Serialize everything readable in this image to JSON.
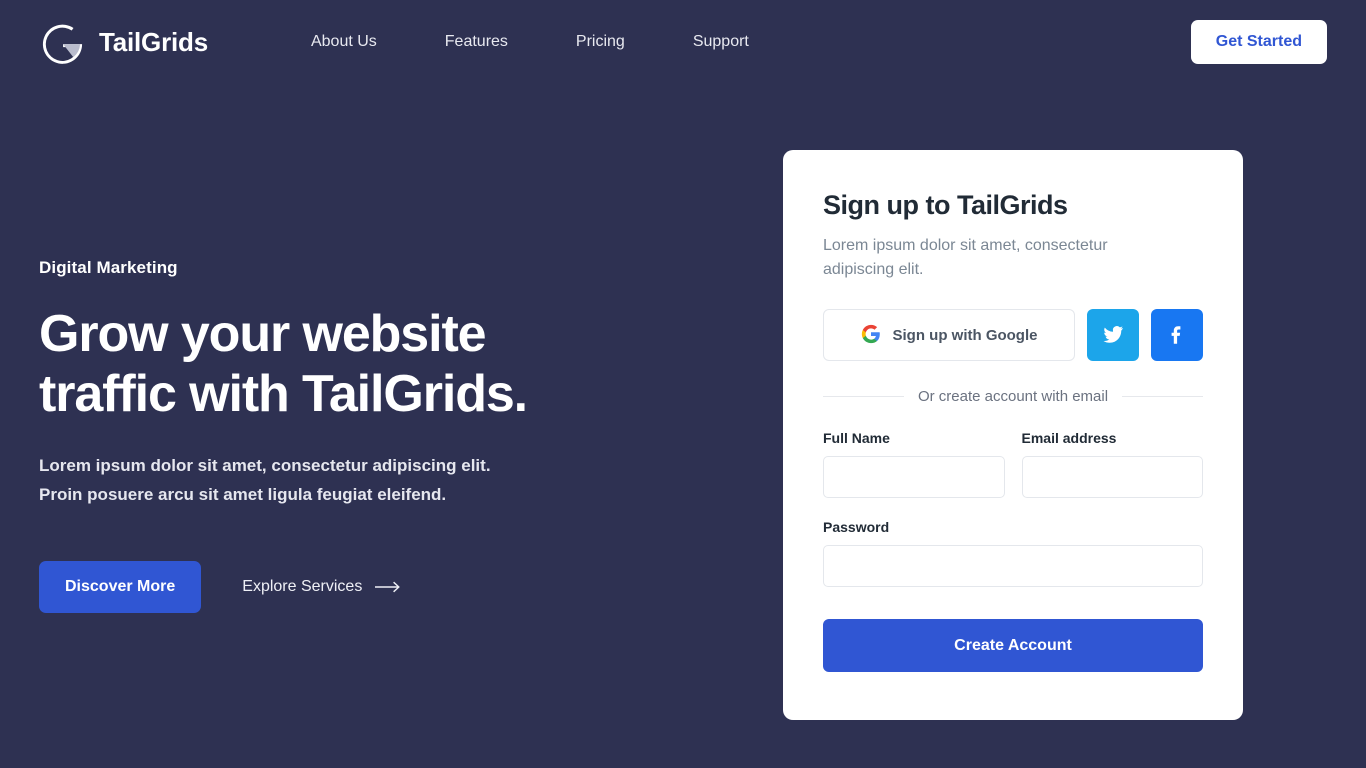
{
  "colors": {
    "page_background": "#2E3152",
    "accent_blue": "#3056D3",
    "card_background": "#FFFFFF",
    "twitter_blue": "#1CA5EA",
    "facebook_blue": "#1877F2",
    "heading_dark": "#212B36",
    "muted_gray": "#7B8794"
  },
  "header": {
    "brand": {
      "name": "TailGrids",
      "logo_icon": "tailgrids-g-logo-icon"
    },
    "nav": [
      {
        "label": "About Us"
      },
      {
        "label": "Features"
      },
      {
        "label": "Pricing"
      },
      {
        "label": "Support"
      }
    ],
    "cta": {
      "label": "Get Started"
    }
  },
  "hero": {
    "eyebrow": "Digital Marketing",
    "title_line1": "Grow your website",
    "title_line2": "traffic with TailGrids.",
    "subtitle_line1": "Lorem ipsum dolor sit amet, consectetur adipiscing elit.",
    "subtitle_line2": "Proin posuere arcu sit amet ligula feugiat eleifend.",
    "primary_button": {
      "label": "Discover More"
    },
    "secondary_link": {
      "label": "Explore Services",
      "icon": "arrow-right-icon"
    }
  },
  "signup": {
    "title": "Sign up to TailGrids",
    "subtitle_line1": "Lorem ipsum dolor sit amet, consectetur",
    "subtitle_line2": "adipiscing elit.",
    "social": {
      "google": {
        "label": "Sign up with Google",
        "icon": "google-icon"
      },
      "twitter": {
        "icon": "twitter-icon",
        "label": ""
      },
      "facebook": {
        "icon": "facebook-icon",
        "label": ""
      }
    },
    "divider_text": "Or create account with email",
    "fields": [
      {
        "label": "Full Name",
        "value": "",
        "placeholder": ""
      },
      {
        "label": "Email address",
        "value": "",
        "placeholder": ""
      },
      {
        "label": "Password",
        "value": "",
        "placeholder": ""
      }
    ],
    "submit": {
      "label": "Create Account"
    }
  }
}
